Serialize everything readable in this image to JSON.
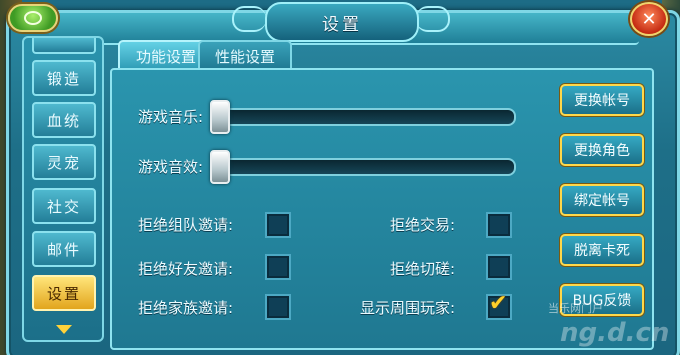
{
  "window": {
    "title": "设置"
  },
  "sidebar": {
    "items": [
      {
        "label": ""
      },
      {
        "label": "锻造"
      },
      {
        "label": "血统"
      },
      {
        "label": "灵宠"
      },
      {
        "label": "社交"
      },
      {
        "label": "邮件"
      },
      {
        "label": "设置",
        "active": true
      }
    ]
  },
  "tabs": [
    {
      "label": "功能设置",
      "active": true
    },
    {
      "label": "性能设置",
      "active": false
    }
  ],
  "sliders": [
    {
      "label": "游戏音乐:",
      "level": 0
    },
    {
      "label": "游戏音效:",
      "level": 0
    }
  ],
  "toggles": [
    {
      "label": "拒绝组队邀请:",
      "checked": false
    },
    {
      "label": "拒绝交易:",
      "checked": false
    },
    {
      "label": "拒绝好友邀请:",
      "checked": false
    },
    {
      "label": "拒绝切磋:",
      "checked": false
    },
    {
      "label": "拒绝家族邀请:",
      "checked": false
    },
    {
      "label": "显示周围玩家:",
      "checked": true
    }
  ],
  "actions": [
    {
      "label": "更换帐号"
    },
    {
      "label": "更换角色"
    },
    {
      "label": "绑定帐号"
    },
    {
      "label": "脱离卡死"
    },
    {
      "label": "BUG反馈"
    }
  ],
  "watermark": {
    "text": "当乐网门户",
    "logo": "ng.d.cn"
  },
  "icons": {
    "close": "close-icon",
    "back": "back-icon",
    "scroll_down": "arrow-down-icon",
    "check": "check-icon"
  },
  "colors": {
    "accent": "#ffd84a",
    "panel": "#1f7891",
    "active_item": "#e2a51d"
  }
}
